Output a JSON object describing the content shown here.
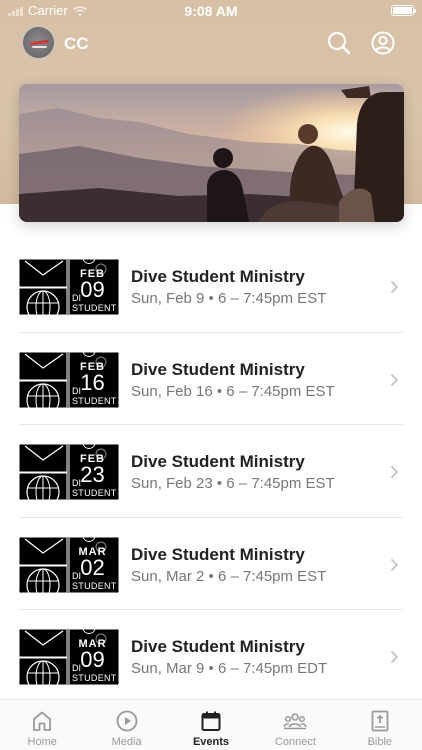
{
  "status_bar": {
    "carrier": "Carrier",
    "time": "9:08 AM"
  },
  "app_bar": {
    "title": "CC",
    "search_icon": "search-icon",
    "profile_icon": "profile-icon"
  },
  "hero": {
    "description_icon": "hero-image"
  },
  "events": [
    {
      "title": "Dive Student Ministry",
      "meta": "Sun, Feb 9 • 6 – 7:45pm EST",
      "month": "FEB",
      "day": "09",
      "thumb_di": "DI",
      "thumb_student": "STUDENT"
    },
    {
      "title": "Dive Student Ministry",
      "meta": "Sun, Feb 16 • 6 – 7:45pm EST",
      "month": "FEB",
      "day": "16",
      "thumb_di": "DI",
      "thumb_student": "STUDENT"
    },
    {
      "title": "Dive Student Ministry",
      "meta": "Sun, Feb 23 • 6 – 7:45pm EST",
      "month": "FEB",
      "day": "23",
      "thumb_di": "DI",
      "thumb_student": "STUDENT"
    },
    {
      "title": "Dive Student Ministry",
      "meta": "Sun, Mar 2 • 6 – 7:45pm EST",
      "month": "MAR",
      "day": "02",
      "thumb_di": "DI",
      "thumb_student": "STUDENT"
    },
    {
      "title": "Dive Student Ministry",
      "meta": "Sun, Mar 9 • 6 – 7:45pm EDT",
      "month": "MAR",
      "day": "09",
      "thumb_di": "DI",
      "thumb_student": "STUDENT"
    }
  ],
  "tabs": [
    {
      "label": "Home",
      "icon": "home-icon",
      "active": false
    },
    {
      "label": "Media",
      "icon": "play-icon",
      "active": false
    },
    {
      "label": "Events",
      "icon": "calendar-icon",
      "active": true
    },
    {
      "label": "Connect",
      "icon": "people-icon",
      "active": false
    },
    {
      "label": "Bible",
      "icon": "bible-icon",
      "active": false
    }
  ],
  "colors": {
    "header": "#d8c0a6",
    "active_tab": "#222222",
    "inactive_tab": "#9a9a9a"
  }
}
